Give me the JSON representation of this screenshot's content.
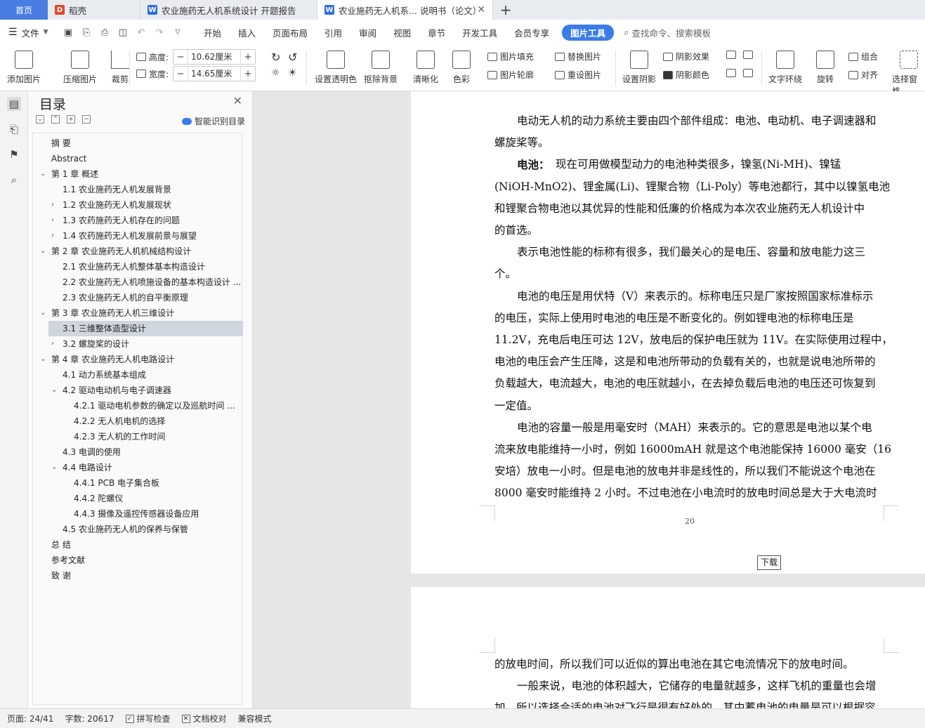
{
  "tabs": {
    "home": "首页",
    "t1": "稻壳",
    "t2": "农业施药无人机系统设计 开题报告",
    "t3": "农业施药无人机系... 说明书（论文）"
  },
  "menu": {
    "file": "文件",
    "items": [
      "开始",
      "插入",
      "页面布局",
      "引用",
      "审阅",
      "视图",
      "章节",
      "开发工具",
      "会员专享"
    ],
    "active": "图片工具",
    "search": "查找命令、搜索模板"
  },
  "ribbon": {
    "add_picture": "添加图片",
    "compress": "压缩图片",
    "crop": "裁剪",
    "height_label": "高度:",
    "height_value": "10.62厘米",
    "width_label": "宽度:",
    "width_value": "14.65厘米",
    "transparent": "设置透明色",
    "remove_bg": "抠除背景",
    "clarify": "清晰化",
    "color": "色彩",
    "fill": "图片填充",
    "outline": "图片轮廓",
    "replace": "替换图片",
    "reset": "重设图片",
    "shadow": "设置阴影",
    "shadow_effect": "阴影效果",
    "shadow_color": "阴影颜色",
    "wrap": "文字环绕",
    "rotate": "旋转",
    "group": "组合",
    "align": "对齐",
    "selection": "选择窗格"
  },
  "toc": {
    "title": "目录",
    "smart": "智能识别目录",
    "items": [
      {
        "text": "摘    要",
        "level": 0,
        "caret": ""
      },
      {
        "text": "Abstract",
        "level": 0,
        "caret": ""
      },
      {
        "text": "第 1 章  概述",
        "level": 0,
        "caret": "v"
      },
      {
        "text": "1.1 农业施药无人机发展背景",
        "level": 1,
        "caret": ""
      },
      {
        "text": "1.2 农业施药无人机发展现状",
        "level": 1,
        "caret": ">"
      },
      {
        "text": "1.3 农药施药无人机存在的问题",
        "level": 1,
        "caret": ">"
      },
      {
        "text": "1.4 农药施药无人机发展前景与展望",
        "level": 1,
        "caret": ">"
      },
      {
        "text": "第 2 章  农业施药无人机机械结构设计",
        "level": 0,
        "caret": "v"
      },
      {
        "text": "2.1 农业施药无人机整体基本构造设计",
        "level": 1,
        "caret": ""
      },
      {
        "text": "2.2 农业施药无人机喷施设备的基本构造设计 ...",
        "level": 1,
        "caret": ""
      },
      {
        "text": "2.3 农业施药无人机的自平衡原理",
        "level": 1,
        "caret": ""
      },
      {
        "text": "第 3 章  农业施药无人机三维设计",
        "level": 0,
        "caret": "v"
      },
      {
        "text": "3.1 三维整体造型设计",
        "level": 1,
        "caret": "",
        "selected": true
      },
      {
        "text": "3.2 螺旋桨的设计",
        "level": 1,
        "caret": ">"
      },
      {
        "text": "第 4 章  农业施药无人机电路设计",
        "level": 0,
        "caret": "v"
      },
      {
        "text": "4.1 动力系统基本组成",
        "level": 1,
        "caret": ""
      },
      {
        "text": "4.2 驱动电动机与电子调速器",
        "level": 1,
        "caret": "v"
      },
      {
        "text": "4.2.1 驱动电机参数的确定以及巡航时间 ...",
        "level": 2,
        "caret": ""
      },
      {
        "text": "4.2.2 无人机电机的选择",
        "level": 2,
        "caret": ""
      },
      {
        "text": "4.2.3 无人机的工作时间",
        "level": 2,
        "caret": ""
      },
      {
        "text": "4.3 电调的使用",
        "level": 1,
        "caret": ""
      },
      {
        "text": "4.4 电路设计",
        "level": 1,
        "caret": "v"
      },
      {
        "text": "4.4.1 PCB 电子集合板",
        "level": 2,
        "caret": ""
      },
      {
        "text": "4.4.2 陀螺仪",
        "level": 2,
        "caret": ""
      },
      {
        "text": "4.4.3 摄像及遥控传感器设备应用",
        "level": 2,
        "caret": ""
      },
      {
        "text": "4.5 农业施药无人机的保养与保管",
        "level": 1,
        "caret": ""
      },
      {
        "text": "总    结",
        "level": 0,
        "caret": ""
      },
      {
        "text": "参考文献",
        "level": 0,
        "caret": ""
      },
      {
        "text": "致    谢",
        "level": 0,
        "caret": ""
      }
    ]
  },
  "doc": {
    "p1_lines": [
      "电动无人机的动力系统主要由四个部件组成：电池、电动机、电子调速器和",
      "螺旋桨等。"
    ],
    "p2_bold": "电池：",
    "p2_first": "现在可用做模型动力的电池种类很多，镍氢(Ni-MH)、镍锰",
    "p2_lines": [
      "(NiOH-MnO2)、锂金属(Li)、锂聚合物（Li-Poly）等电池都行，其中以镍氢电池",
      "和锂聚合物电池以其优异的性能和低廉的价格成为本次农业施药无人机设计中",
      "的首选。"
    ],
    "p3_lines": [
      "表示电池性能的标称有很多，我们最关心的是电压、容量和放电能力这三",
      "个。"
    ],
    "p4_lines": [
      "电池的电压是用伏特（V）来表示的。标称电压只是厂家按照国家标准标示",
      "的电压，实际上使用时电池的电压是不断变化的。例如锂电池的标称电压是",
      "11.2V，充电后电压可达 12V，放电后的保护电压就为 11V。在实际使用过程中，",
      "电池的电压会产生压降，这是和电池所带动的负载有关的，也就是说电池所带的",
      "负载越大，电流越大，电池的电压就越小，在去掉负载后电池的电压还可恢复到",
      "一定值。"
    ],
    "p5_lines": [
      "电池的容量一般是用毫安时（MAH）来表示的。它的意思是电池以某个电",
      "流来放电能维持一小时，例如 16000mAH 就是这个电池能保持 16000 毫安（16",
      "安培）放电一小时。但是电池的放电并非是线性的，所以我们不能说这个电池在",
      "8000 毫安时能维持 2 小时。不过电池在小电流时的放电时间总是大于大电流时"
    ],
    "page_number": "20",
    "download": "下载",
    "p6_lines": [
      "的放电时间，所以我们可以近似的算出电池在其它电流情况下的放电时间。",
      "一般来说，电池的体积越大，它储存的电量就越多，这样飞机的重量也会增",
      "加，所以选择合适的电池对飞行是很有好处的。其中蓄电池的电量是可以根据容"
    ]
  },
  "status": {
    "page": "页面: 24/41",
    "words": "字数: 20617",
    "spell": "拼写检查",
    "proof": "文档校对",
    "compat": "兼容模式"
  }
}
